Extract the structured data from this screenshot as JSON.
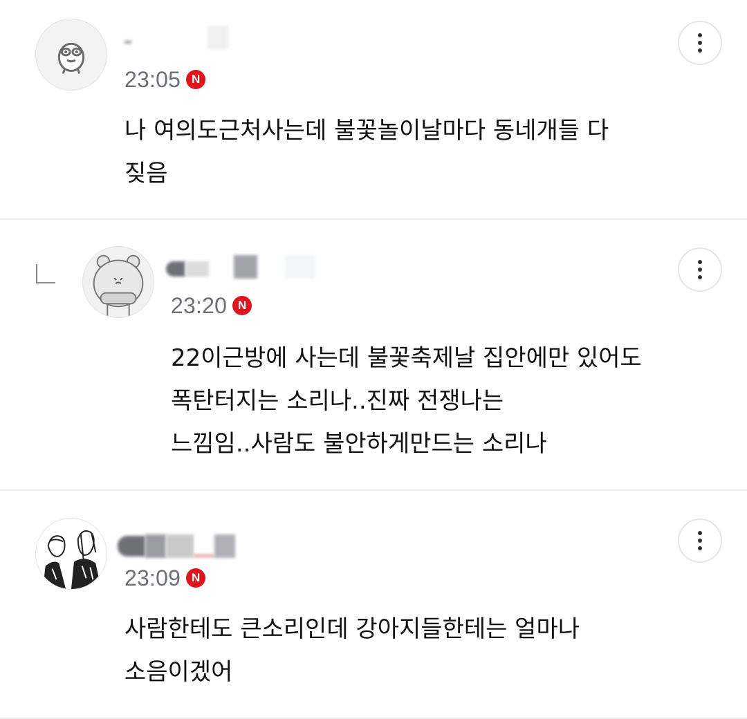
{
  "comments": [
    {
      "time": "23:05",
      "badge": "N",
      "text": "나 여의도근처사는데 불꽃놀이날마다 동네개들 다\n짖음",
      "is_reply": false
    },
    {
      "time": "23:20",
      "badge": "N",
      "text": "22이근방에 사는데 불꽃축제날 집안에만 있어도\n폭탄터지는 소리나..진짜 전쟁나는\n느낌임..사람도 불안하게만드는 소리나",
      "is_reply": true
    },
    {
      "time": "23:09",
      "badge": "N",
      "text": "사람한테도 큰소리인데 강아지들한테는 얼마나\n소음이겠어",
      "is_reply": false
    }
  ],
  "icons": {
    "more": "more-vertical-icon",
    "reply": "reply-arrow-icon",
    "badge": "new-badge-icon"
  },
  "colors": {
    "badge": "#e0141b",
    "time": "#6d6f78",
    "divider": "#ececec"
  }
}
